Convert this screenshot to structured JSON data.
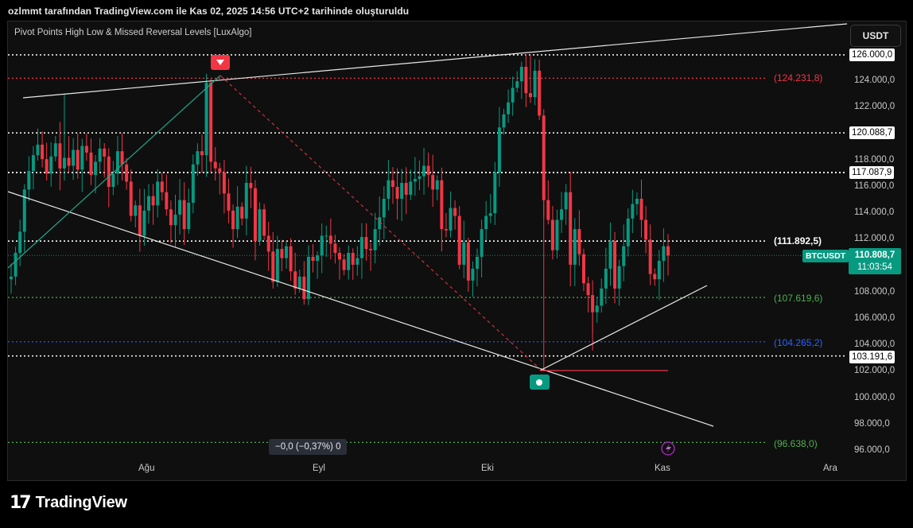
{
  "header": {
    "attribution": "ozlmmt tarafından TradingView.com ile Kas 02, 2025 14:56 UTC+2 tarihinde oluşturuldu"
  },
  "indicator": {
    "title": "Pivot Points High Low & Missed Reversal Levels [LuxAlgo]"
  },
  "toolbar": {
    "currency": "USDT"
  },
  "price_axis": [
    "126.000,0",
    "124.000,0",
    "122.000,0",
    "120.000,0",
    "118.000,0",
    "116.000,0",
    "114.000,0",
    "112.000,0",
    "110.000,0",
    "108.000,0",
    "106.000,0",
    "104.000,0",
    "102.000,0",
    "100.000,0",
    "98.000,0",
    "96.000,0"
  ],
  "time_axis": [
    "Ağu",
    "Eyl",
    "Eki",
    "Kas",
    "Ara"
  ],
  "price_tags": {
    "p126": "126.000,0",
    "p120": "120.088,7",
    "p117": "117.087,9",
    "p103": "103.191,6"
  },
  "levels": {
    "l124": "(124.231,8)",
    "l111": "(111.892,5)",
    "l107": "(107.619,6)",
    "l104": "(104.265,2)",
    "l96": "(96.638,0)"
  },
  "current": {
    "symbol": "BTCUSDT",
    "price": "110.808,7",
    "countdown": "11:03:54"
  },
  "measure": {
    "text": "−0,0 (−0,37%) 0"
  },
  "footer": {
    "logo_text": "TradingView"
  },
  "colors": {
    "up": "#089981",
    "down": "#f23645",
    "level_red": "#f23645",
    "level_green": "#4caf50",
    "level_blue": "#2962ff",
    "level_white": "#ffffff"
  },
  "chart_data": {
    "type": "candlestick",
    "symbol": "BTCUSDT",
    "ylim": [
      95000,
      127500
    ],
    "levels": [
      124231.8,
      111892.5,
      107619.6,
      104265.2,
      96638.0,
      126000.0,
      120088.7,
      117087.9,
      103191.6
    ],
    "close_path": [
      109200,
      111000,
      112600,
      115800,
      117200,
      118400,
      119200,
      118100,
      117000,
      118300,
      119300,
      117400,
      118200,
      117600,
      118800,
      117300,
      119100,
      118600,
      116900,
      117900,
      118900,
      118300,
      116000,
      117000,
      118700,
      117700,
      116400,
      113800,
      114600,
      112300,
      114200,
      115300,
      114600,
      116400,
      115600,
      114300,
      113100,
      113900,
      115000,
      112800,
      114800,
      117700,
      118700,
      118400,
      123900,
      117900,
      117400,
      117100,
      115500,
      114200,
      112800,
      114500,
      113600,
      116300,
      115900,
      111900,
      114300,
      112300,
      111100,
      108800,
      111300,
      110600,
      111500,
      109600,
      108300,
      109200,
      107500,
      110700,
      110400,
      110800,
      112300,
      112300,
      111700,
      111000,
      110500,
      109700,
      111000,
      110100,
      110600,
      112200,
      111300,
      111200,
      112800,
      113700,
      115100,
      116500,
      116000,
      115100,
      116300,
      115400,
      116400,
      116600,
      116800,
      117600,
      116900,
      115800,
      116500,
      112800,
      112700,
      114400,
      113800,
      110100,
      111800,
      108900,
      109800,
      110700,
      112800,
      113800,
      114000,
      117100,
      120500,
      121500,
      122400,
      123500,
      124000,
      125100,
      123100,
      122800,
      124800,
      121400,
      115000,
      113500,
      111200,
      113500,
      114300,
      115600,
      110100,
      112800,
      110900,
      108700,
      107800,
      106500,
      107000,
      108300,
      109800,
      111900,
      108300,
      110000,
      111500,
      113600,
      114700,
      115100,
      113500,
      112000,
      109400,
      109000,
      110400,
      111500,
      110800
    ]
  }
}
